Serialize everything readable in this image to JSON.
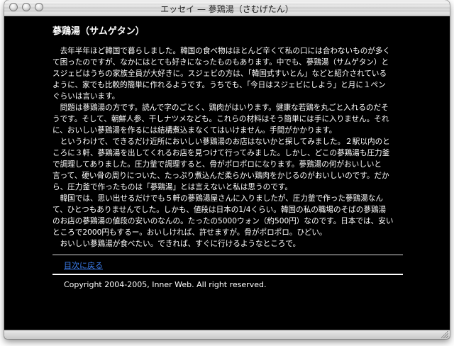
{
  "window": {
    "title": "エッセイ — 蔘鶏湯（さむげたん）"
  },
  "article": {
    "heading": "蔘鶏湯（サムゲタン）",
    "lines": [
      "　去年半年ほど韓国で暮らしました。韓国の食べ物はほとんど辛くて私の口には合わないものが多く",
      "て困ったのですが、なかにはとても好きになったものもあります。中でも、蔘鶏湯（サムゲタン）と",
      "スジェビはうちの家族全員が大好きに。スジェビの方は、「韓国式すいとん」などと紹介されている",
      "ように、家でも比較的簡単に作れるようです。うちでも、「今日はスジェビにしよう」と月に１ペン",
      "ぐらいは言います。",
      "　問題は蔘鶏湯の方です。読んで字のごとく、鶏肉がはいります。健康な若鶏を丸ごと入れるのだそ",
      "うです。そして、朝鮮人参、干しナツメなども。これらの材料はそう簡単には手に入りません。それ",
      "に、おいしい蔘鶏湯を作るには結構煮込まなくてはいけません。手間がかかります。",
      "　というわけで、できるだけ近所においしい蔘鶏湯のお店はないかと探してみました。２駅以内のと",
      "ころに３軒、蔘鶏湯を出してくれるお店を見つけて行ってみました。しかし、どこの蔘鶏湯も圧力釜",
      "で調理してありました。圧力釜で調理すると、骨がポロポロになります。蔘鶏湯の何がおいしいと",
      "言って、硬い骨の周りについた、たっぷり煮込んだ柔らかい鶏肉をかじるのがおいしいのです。だか",
      "ら、圧力釜で作ったものは「蔘鶏湯」とは言えないと私は思うのです。",
      "　韓国では、思い出せるだけでも５軒の蔘鶏湯屋さんに入りましたが、圧力釜で作った蔘鶏湯なん",
      "て、ひとつもありませんでした。しかも、値段は日本の1/4くらい。韓国の私の職場のそばの蔘鶏湯",
      "のお店の蔘鶏湯の値段の安いのなんの。たったの5000ウォン（約500円）なのです。日本では、安い",
      "ところで2000円もするー。おいしければ、許せますが。骨がポロポロ。ひどい。",
      "　おいしい蔘鶏湯が食べたい。できれば、すぐに行けるようなところで。"
    ]
  },
  "footer": {
    "back_link": "目次に戻る",
    "copyright": "Copyright 2004-2005, Inner Web. All right reserved."
  }
}
